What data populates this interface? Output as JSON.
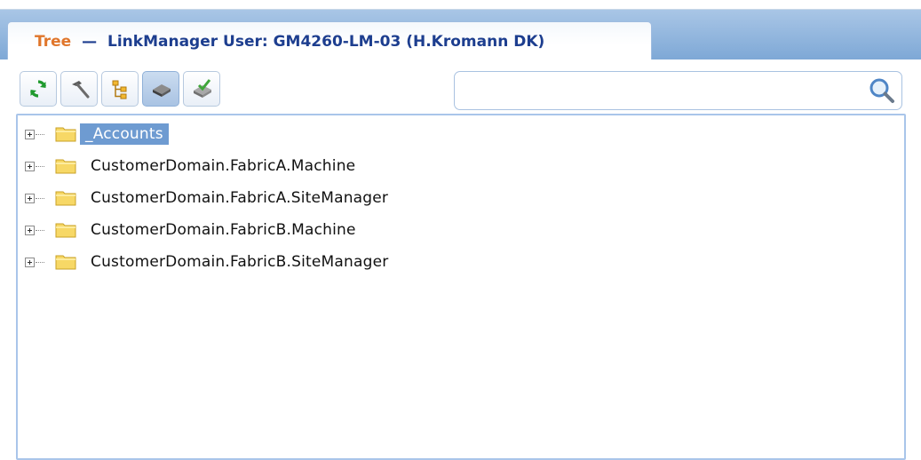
{
  "tab": {
    "title": "Tree",
    "separator": "—",
    "subtitle": "LinkManager User: GM4260-LM-03 (H.Kromann DK)"
  },
  "toolbar": {
    "buttons": [
      {
        "icon": "refresh-icon",
        "pressed": false
      },
      {
        "icon": "hammer-icon",
        "pressed": false
      },
      {
        "icon": "tree-structure-icon",
        "pressed": false
      },
      {
        "icon": "device-icon",
        "pressed": true
      },
      {
        "icon": "device-check-icon",
        "pressed": false
      }
    ]
  },
  "search": {
    "value": "",
    "placeholder": "",
    "icon": "magnifier-icon"
  },
  "tree": {
    "nodes": [
      {
        "label": "_Accounts",
        "selected": true,
        "icon": "folder-icon"
      },
      {
        "label": "CustomerDomain.FabricA.Machine",
        "selected": false,
        "icon": "folder-icon"
      },
      {
        "label": "CustomerDomain.FabricA.SiteManager",
        "selected": false,
        "icon": "folder-icon"
      },
      {
        "label": "CustomerDomain.FabricB.Machine",
        "selected": false,
        "icon": "folder-icon"
      },
      {
        "label": "CustomerDomain.FabricB.SiteManager",
        "selected": false,
        "icon": "folder-icon"
      }
    ]
  },
  "colors": {
    "tab_title": "#e0762b",
    "tab_subtitle": "#1d3e8f",
    "selection": "#6e9bd1",
    "header_gradient": "#8fb3dc"
  }
}
